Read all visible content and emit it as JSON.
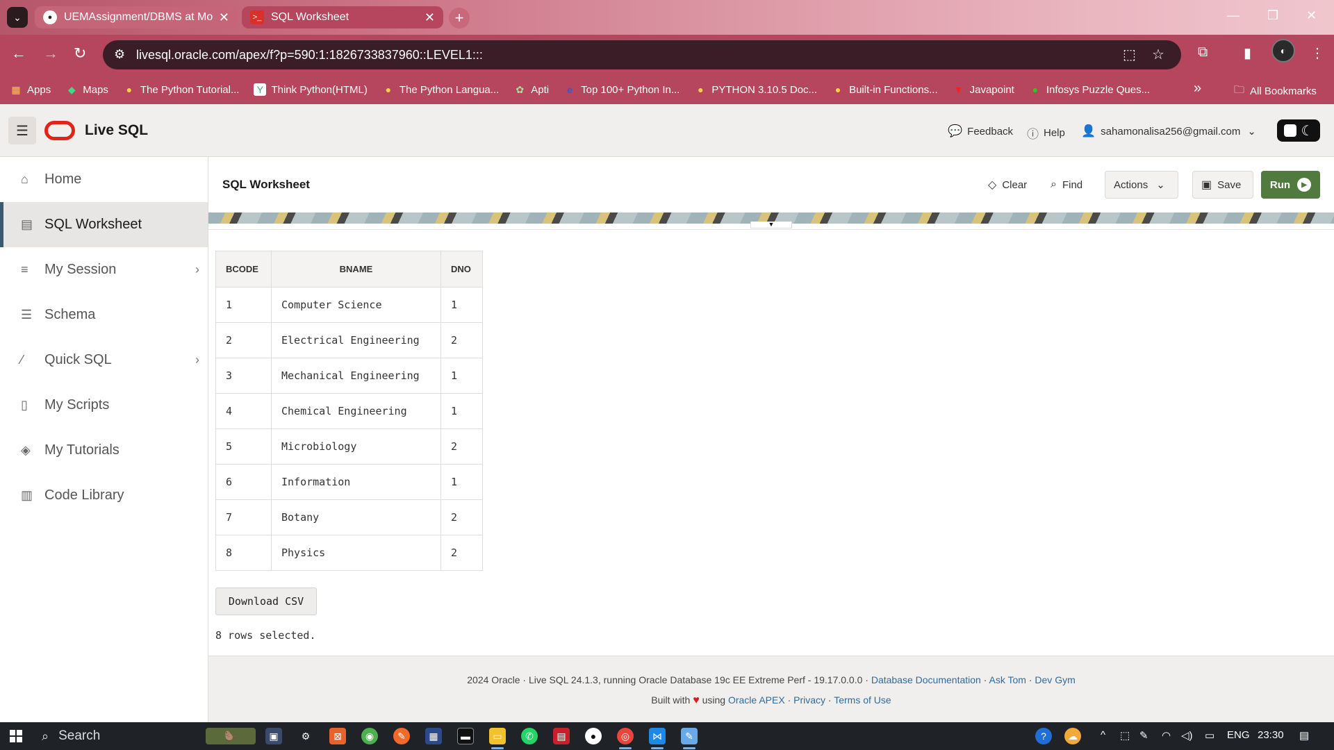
{
  "browser": {
    "tabs": [
      {
        "title": "UEMAssignment/DBMS at Mon",
        "close": "✕"
      },
      {
        "title": "SQL Worksheet",
        "close": "✕"
      }
    ],
    "new_tab": "+",
    "url": "livesql.oracle.com/apex/f?p=590:1:1826733837960::LEVEL1:::",
    "bookmarks": [
      {
        "label": "Apps",
        "icon": "apps-grid-icon"
      },
      {
        "label": "Maps",
        "icon": "maps-pin-icon"
      },
      {
        "label": "The Python Tutorial...",
        "icon": "python-icon"
      },
      {
        "label": "Think Python(HTML)",
        "icon": "think-python-icon"
      },
      {
        "label": "The Python Langua...",
        "icon": "python-icon"
      },
      {
        "label": "Apti",
        "icon": "apti-icon"
      },
      {
        "label": "Top 100+ Python In...",
        "icon": "edureka-icon"
      },
      {
        "label": "PYTHON 3.10.5 Doc...",
        "icon": "python-icon"
      },
      {
        "label": "Built-in Functions...",
        "icon": "python-icon"
      },
      {
        "label": "Javapoint",
        "icon": "javatpoint-icon"
      },
      {
        "label": "Infosys Puzzle Ques...",
        "icon": "infosys-icon"
      }
    ],
    "bookmarks_more": "»",
    "all_bookmarks": "All Bookmarks"
  },
  "header": {
    "app_title": "Live SQL",
    "feedback": "Feedback",
    "help": "Help",
    "user": "sahamonalisa256@gmail.com"
  },
  "sidebar": {
    "items": [
      {
        "label": "Home",
        "icon": "home-icon"
      },
      {
        "label": "SQL Worksheet",
        "icon": "sql-worksheet-icon"
      },
      {
        "label": "My Session",
        "icon": "list-icon"
      },
      {
        "label": "Schema",
        "icon": "database-icon"
      },
      {
        "label": "Quick SQL",
        "icon": "magic-wand-icon"
      },
      {
        "label": "My Scripts",
        "icon": "script-icon"
      },
      {
        "label": "My Tutorials",
        "icon": "graduation-cap-icon"
      },
      {
        "label": "Code Library",
        "icon": "library-icon"
      }
    ]
  },
  "worksheet": {
    "title": "SQL Worksheet",
    "clear": "Clear",
    "find": "Find",
    "actions": "Actions",
    "save": "Save",
    "run": "Run"
  },
  "results": {
    "columns": [
      "BCODE",
      "BNAME",
      "DNO"
    ],
    "rows": [
      [
        "1",
        "Computer Science",
        "1"
      ],
      [
        "2",
        "Electrical Engineering",
        "2"
      ],
      [
        "3",
        "Mechanical Engineering",
        "1"
      ],
      [
        "4",
        "Chemical Engineering",
        "1"
      ],
      [
        "5",
        "Microbiology",
        "2"
      ],
      [
        "6",
        "Information",
        "1"
      ],
      [
        "7",
        "Botany",
        "2"
      ],
      [
        "8",
        "Physics",
        "2"
      ]
    ],
    "download_csv": "Download CSV",
    "rows_selected": "8 rows selected."
  },
  "footer": {
    "line1_text": "2024 Oracle · Live SQL 24.1.3, running Oracle Database 19c EE Extreme Perf - 19.17.0.0.0 ·",
    "database_documentation": "Database Documentation",
    "ask_tom": "Ask Tom",
    "dev_gym": "Dev Gym",
    "built_with": "Built with",
    "using": "using",
    "oracle_apex": "Oracle APEX",
    "privacy": "Privacy",
    "terms": "Terms of Use",
    "sep": "·"
  },
  "taskbar": {
    "search": "Search",
    "lang": "ENG",
    "time": "23:30"
  },
  "colors": {
    "chrome_tabbar": "#b5465d",
    "oracle_red": "#e2231a",
    "run_green": "#507a3e",
    "link_blue": "#2f6a9e"
  }
}
